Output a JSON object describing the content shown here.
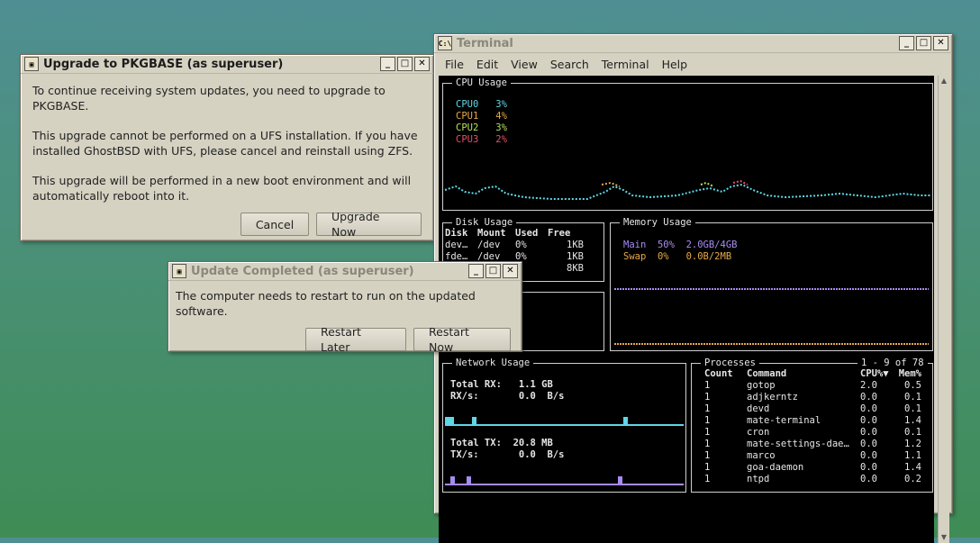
{
  "colors": {
    "cpu0": "#5fd7e6",
    "cpu1": "#e8a84a",
    "cpu2": "#b5e05a",
    "cpu3": "#ea4d6b",
    "network": "#5fd7e6",
    "tx": "#a68cf0"
  },
  "icons": {
    "app": "terminal-icon",
    "minimize": "minimize-icon",
    "maximize": "maximize-icon",
    "close": "close-icon"
  },
  "upgrade_dialog": {
    "title": "Upgrade to PKGBASE (as superuser)",
    "para1": "To continue receiving system updates, you need to upgrade to PKGBASE.",
    "para2": "This upgrade cannot be performed on a UFS installation. If you have installed GhostBSD with UFS, please cancel and reinstall using ZFS.",
    "para3": "This upgrade will be performed in a new boot environment and will automatically reboot into it.",
    "cancel": "Cancel",
    "upgrade": "Upgrade Now"
  },
  "update_dialog": {
    "title": "Update Completed (as superuser)",
    "message": "The computer needs to restart to run on the updated software.",
    "later": "Restart Later",
    "now": "Restart Now"
  },
  "terminal": {
    "title": "Terminal",
    "menu": [
      "File",
      "Edit",
      "View",
      "Search",
      "Terminal",
      "Help"
    ],
    "cpu": {
      "title": "CPU Usage",
      "rows": [
        {
          "name": "CPU0",
          "value": "3%"
        },
        {
          "name": "CPU1",
          "value": "4%"
        },
        {
          "name": "CPU2",
          "value": "3%"
        },
        {
          "name": "CPU3",
          "value": "2%"
        }
      ]
    },
    "disk": {
      "title": "Disk Usage",
      "headers": [
        "Disk",
        "Mount",
        "Used",
        "Free"
      ],
      "rows": [
        [
          "dev…",
          "/dev",
          "0%",
          "1KB"
        ],
        [
          "fde…",
          "/dev",
          "0%",
          "1KB"
        ],
        [
          "",
          "",
          "",
          "8KB"
        ]
      ]
    },
    "memory": {
      "title": "Memory Usage",
      "main": {
        "label": "Main",
        "pct": "50%",
        "amount": "2.0GB/4GB"
      },
      "swap": {
        "label": "Swap",
        "pct": "0%",
        "amount": "0.0B/2MB"
      }
    },
    "network": {
      "title": "Network Usage",
      "total_rx_label": "Total RX:",
      "total_rx": "1.1 GB",
      "rx_label": "RX/s:",
      "rx": "0.0  B/s",
      "total_tx_label": "Total TX:",
      "total_tx": "20.8 MB",
      "tx_label": "TX/s:",
      "tx": "0.0  B/s"
    },
    "processes": {
      "title": "Processes",
      "page": "1 - 9 of 78",
      "headers": [
        "Count",
        "Command",
        "CPU%▼",
        "Mem%"
      ],
      "rows": [
        [
          "1",
          "gotop",
          "2.0",
          "0.5"
        ],
        [
          "1",
          "adjkerntz",
          "0.0",
          "0.1"
        ],
        [
          "1",
          "devd",
          "0.0",
          "0.1"
        ],
        [
          "1",
          "mate-terminal",
          "0.0",
          "1.4"
        ],
        [
          "1",
          "cron",
          "0.0",
          "0.1"
        ],
        [
          "1",
          "mate-settings-dae…",
          "0.0",
          "1.2"
        ],
        [
          "1",
          "marco",
          "0.0",
          "1.1"
        ],
        [
          "1",
          "goa-daemon",
          "0.0",
          "1.4"
        ],
        [
          "1",
          "ntpd",
          "0.0",
          "0.2"
        ]
      ]
    }
  }
}
